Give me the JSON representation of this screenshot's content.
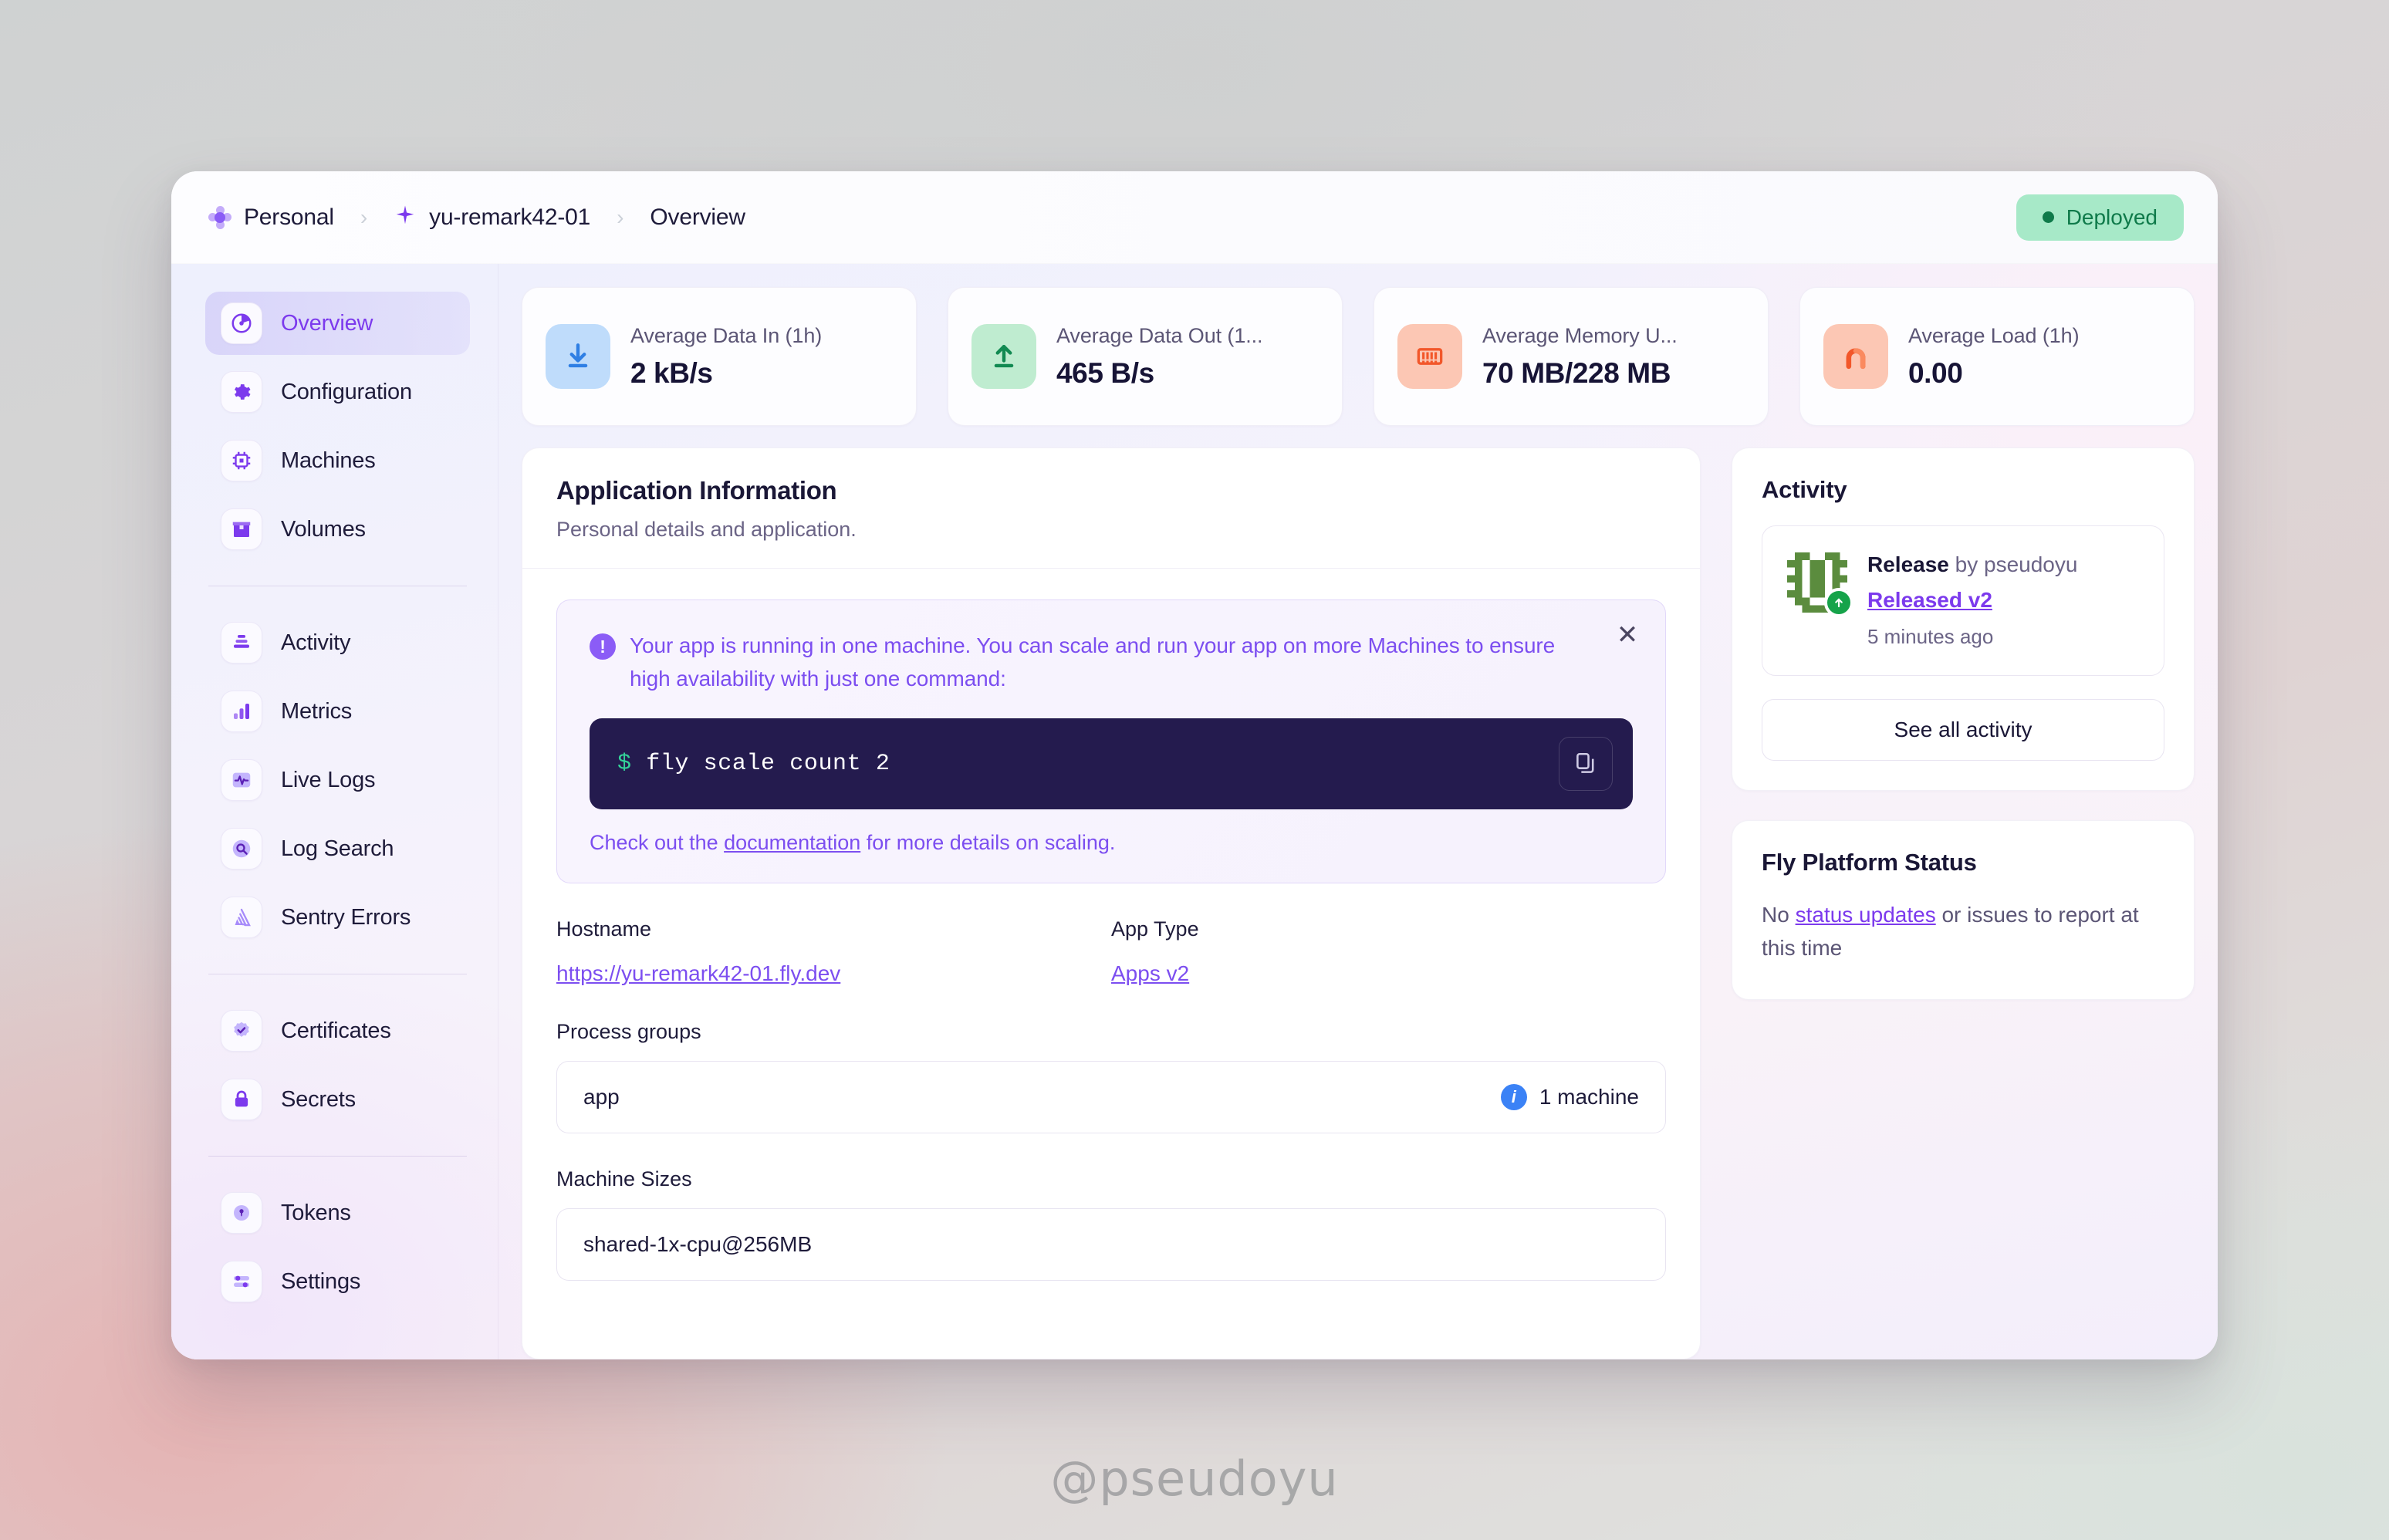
{
  "breadcrumb": {
    "org": "Personal",
    "app": "yu-remark42-01",
    "page": "Overview",
    "separator": "›"
  },
  "status_badge": {
    "label": "Deployed",
    "color": "#0f7a4a",
    "bg": "#a7e9c8"
  },
  "sidebar": {
    "groups": [
      {
        "items": [
          {
            "label": "Overview",
            "icon": "pie-chart-icon",
            "active": true
          },
          {
            "label": "Configuration",
            "icon": "gear-icon",
            "active": false
          },
          {
            "label": "Machines",
            "icon": "cpu-chip-icon",
            "active": false
          },
          {
            "label": "Volumes",
            "icon": "box-icon",
            "active": false
          }
        ]
      },
      {
        "items": [
          {
            "label": "Activity",
            "icon": "layers-icon",
            "active": false
          },
          {
            "label": "Metrics",
            "icon": "bar-chart-icon",
            "active": false
          },
          {
            "label": "Live Logs",
            "icon": "pulse-icon",
            "active": false
          },
          {
            "label": "Log Search",
            "icon": "search-icon",
            "active": false
          },
          {
            "label": "Sentry Errors",
            "icon": "sentry-icon",
            "active": false
          }
        ]
      },
      {
        "items": [
          {
            "label": "Certificates",
            "icon": "badge-check-icon",
            "active": false
          },
          {
            "label": "Secrets",
            "icon": "lock-icon",
            "active": false
          }
        ]
      },
      {
        "items": [
          {
            "label": "Tokens",
            "icon": "key-icon",
            "active": false
          },
          {
            "label": "Settings",
            "icon": "sliders-icon",
            "active": false
          }
        ]
      }
    ]
  },
  "stats": [
    {
      "label": "Average Data In (1h)",
      "value": "2 kB/s",
      "icon": "download-icon",
      "bg": "#bfdcfb",
      "fg": "#2f7fe4"
    },
    {
      "label": "Average Data Out (1...",
      "value": "465 B/s",
      "icon": "upload-icon",
      "bg": "#bfecd0",
      "fg": "#128a52"
    },
    {
      "label": "Average Memory U...",
      "value": "70 MB/228 MB",
      "icon": "memory-icon",
      "bg": "#fcc7b4",
      "fg": "#f2572a"
    },
    {
      "label": "Average Load (1h)",
      "value": "0.00",
      "icon": "gauge-icon",
      "bg": "#fcc7b4",
      "fg": "#f2572a"
    }
  ],
  "app_info": {
    "title": "Application Information",
    "subtitle": "Personal details and application.",
    "alert": {
      "icon": "exclamation-icon",
      "close_icon": "close-icon",
      "message": "Your app is running in one machine. You can scale and run your app on more Machines to ensure high availability with just one command:",
      "command_prompt": "$",
      "command": "fly scale count 2",
      "copy_icon": "copy-icon",
      "footer_before": "Check out the ",
      "footer_link": "documentation",
      "footer_after": " for more details on scaling."
    },
    "hostname_label": "Hostname",
    "hostname_value": "https://yu-remark42-01.fly.dev",
    "app_type_label": "App Type",
    "app_type_value": "Apps v2",
    "process_groups_label": "Process groups",
    "process_group_name": "app",
    "process_group_count": "1 machine",
    "machine_sizes_label": "Machine Sizes",
    "machine_size_value": "shared-1x-cpu@256MB"
  },
  "activity": {
    "title": "Activity",
    "item": {
      "type": "Release",
      "by_text": " by pseudoyu",
      "link": "Released v2",
      "time": "5 minutes ago"
    },
    "see_all_label": "See all activity"
  },
  "platform_status": {
    "title": "Fly Platform Status",
    "text_before": "No ",
    "link": "status updates",
    "text_after": " or issues to report at this time"
  },
  "watermark": "@pseudoyu"
}
